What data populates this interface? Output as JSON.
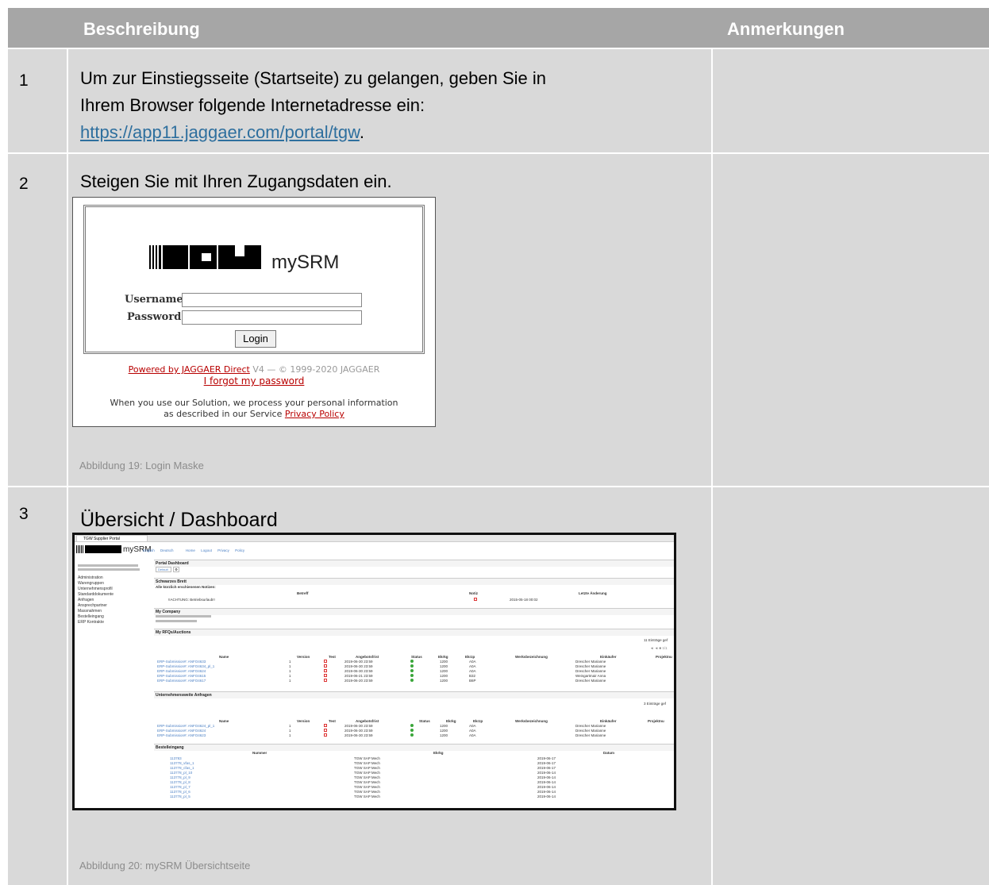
{
  "table": {
    "headers": {
      "description": "Beschreibung",
      "notes": "Anmerkungen"
    },
    "rows": [
      {
        "num": "1",
        "text_line1": "Um zur Einstiegsseite (Startseite) zu gelangen, geben Sie in",
        "text_line2": "Ihrem Browser folgende Internetadresse ein:",
        "link": "https://app11.jaggaer.com/portal/tgw",
        "link_suffix": "."
      },
      {
        "num": "2",
        "text": "Steigen Sie mit Ihren Zugangsdaten ein.",
        "caption": "Abbildung 19: Login Maske"
      },
      {
        "num": "3",
        "text": "Übersicht / Dashboard",
        "caption": "Abbildung 20: mySRM Übersichtseite"
      }
    ]
  },
  "login": {
    "logo_text": "TGW",
    "product": "mySRM",
    "username_label": "Username",
    "password_label": "Password",
    "login_button": "Login",
    "powered_link": "Powered by JAGGAER Direct",
    "version": "V4 — © 1999-2020 JAGGAER",
    "forgot_link": "I forgot my password",
    "privacy_line1": "When you use our Solution, we process your personal information",
    "privacy_line2": "as described in our Service",
    "privacy_link": "Privacy Policy"
  },
  "dashboard": {
    "tab_title": "TGW Supplier Portal",
    "product": "mySRM",
    "top_links": [
      "English",
      "Deutsch",
      "Home",
      "Logout",
      "Privacy Policy"
    ],
    "sidebar": [
      "Administration",
      "Warengruppen",
      "Unternehmensprofil",
      "Standarddokumente",
      "Anfragen",
      "Ansprechpartner",
      "Massnahmen",
      "Bestelleingang",
      "ERP Kontrakte"
    ],
    "portal_title": "Portal Dashboard",
    "default_btn": "Default",
    "board_title": "Schwarzes Brett",
    "board_sub": "Alle kürzlich erschienenen Notizen:",
    "board_cols": [
      "Betreff",
      "Notiz",
      "Letzte Änderung"
    ],
    "board_row": {
      "subject": "!!ACHTUNG: Betriebsurlaub!!",
      "date": "2015-05-18 00:02"
    },
    "company_title": "My Company",
    "rfq_title": "My RFQs/Auctions",
    "rfq_count": "11 Einträge gef",
    "rfq_cols": [
      "Name",
      "Version",
      "Test",
      "Angebotsfrist",
      "Status",
      "Ekrkg",
      "Ekrzp",
      "Werksbezeichnung",
      "Einkäufer",
      "Projektnu"
    ],
    "rfq_rows": [
      {
        "name": "ERP-Submission#: ANFO4633",
        "ver": "1",
        "date": "2019-06-30 23:59",
        "ekrkg": "1200",
        "ekrzp": "A0A",
        "buyer": "Drescher Marianne"
      },
      {
        "name": "ERP-Submission#: ANFO4634_pl_1",
        "ver": "1",
        "date": "2019-06-30 23:59",
        "ekrkg": "1200",
        "ekrzp": "A0A",
        "buyer": "Drescher Marianne"
      },
      {
        "name": "ERP-Submission#: ANFO4624",
        "ver": "1",
        "date": "2019-06-30 23:59",
        "ekrkg": "1200",
        "ekrzp": "A0A",
        "buyer": "Drescher Marianne"
      },
      {
        "name": "ERP-Submission#: ANFO4615",
        "ver": "1",
        "date": "2019-06-21 23:59",
        "ekrkg": "1200",
        "ekrzp": "B32",
        "buyer": "Weingartmair Anna"
      },
      {
        "name": "ERP-Submission#: ANFO4617",
        "ver": "1",
        "date": "2019-06-20 23:59",
        "ekrkg": "1200",
        "ekrzp": "B6P",
        "buyer": "Drescher Marianne"
      }
    ],
    "ent_title": "Unternehmensweite Anfragen",
    "ent_count": "3 Einträge gef",
    "ent_rows": [
      {
        "name": "ERP-Submission#: ANFO4624_pl_1",
        "ver": "1",
        "date": "2019-06-30 23:59",
        "ekrkg": "1200",
        "ekrzp": "A0A",
        "buyer": "Drescher Marianne"
      },
      {
        "name": "ERP-Submission#: ANFO4624",
        "ver": "1",
        "date": "2019-06-30 23:59",
        "ekrkg": "1200",
        "ekrzp": "A0A",
        "buyer": "Drescher Marianne"
      },
      {
        "name": "ERP-Submission#: ANFO4623",
        "ver": "1",
        "date": "2019-06-30 23:59",
        "ekrkg": "1200",
        "ekrzp": "A0A",
        "buyer": "Drescher Marianne"
      }
    ],
    "po_title": "Bestelleingang",
    "po_cols": [
      "Nummer",
      "Ekrkg",
      "Datum"
    ],
    "po_rows": [
      {
        "num": "113783",
        "org": "TGW SAP Mech",
        "date": "2019-06-17"
      },
      {
        "num": "113778_vfas_1",
        "org": "TGW SAP Mech",
        "date": "2019-06-17"
      },
      {
        "num": "113778_cfas_1",
        "org": "TGW SAP Mech",
        "date": "2019-06-17"
      },
      {
        "num": "113778_pl_10",
        "org": "TGW SAP Mech",
        "date": "2019-06-14"
      },
      {
        "num": "113778_pl_9",
        "org": "TGW SAP Mech",
        "date": "2019-06-14"
      },
      {
        "num": "113778_pl_8",
        "org": "TGW SAP Mech",
        "date": "2019-06-14"
      },
      {
        "num": "113778_pl_7",
        "org": "TGW SAP Mech",
        "date": "2019-06-14"
      },
      {
        "num": "113778_pl_6",
        "org": "TGW SAP Mech",
        "date": "2019-06-14"
      },
      {
        "num": "113778_pl_5",
        "org": "TGW SAP Mech",
        "date": "2019-06-14"
      }
    ]
  }
}
